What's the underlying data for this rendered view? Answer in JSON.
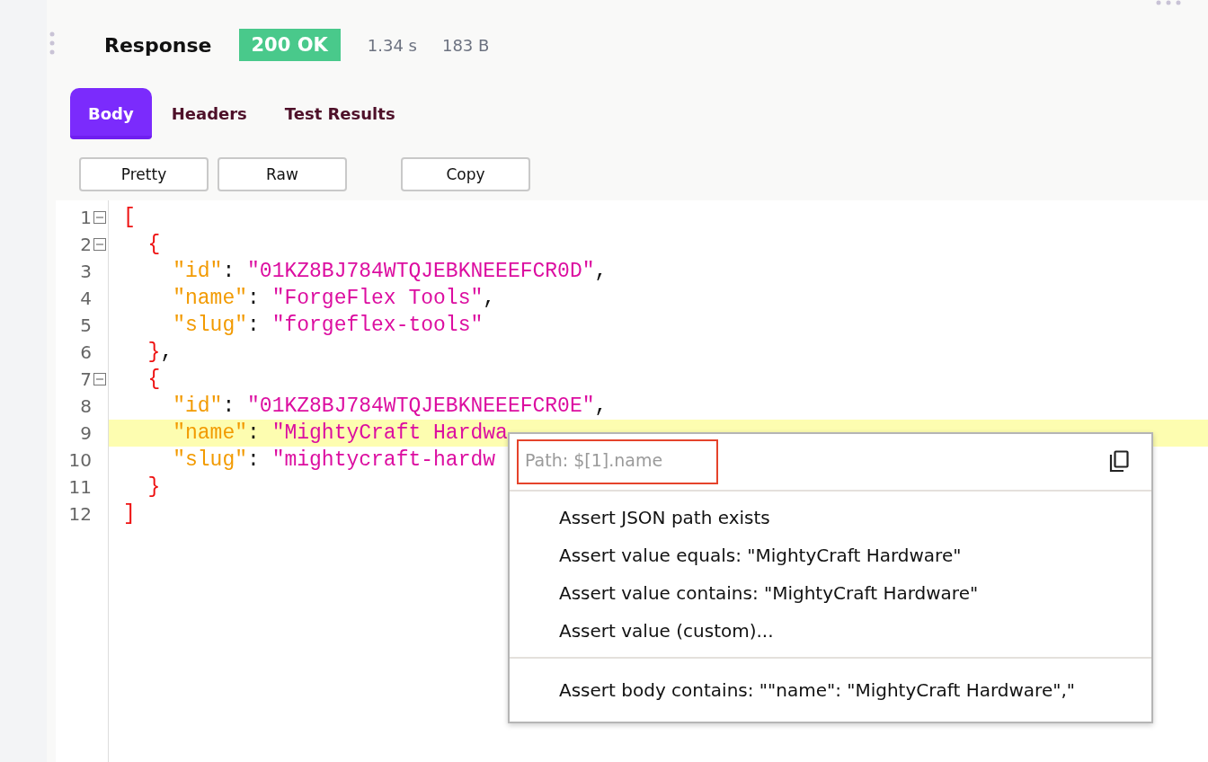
{
  "response": {
    "title": "Response",
    "status": "200 OK",
    "time": "1.34 s",
    "size": "183 B"
  },
  "tabs": [
    {
      "label": "Body",
      "selected": true
    },
    {
      "label": "Headers",
      "selected": false
    },
    {
      "label": "Test Results",
      "selected": false
    }
  ],
  "view_buttons": [
    "Pretty",
    "Raw"
  ],
  "copy_button": "Copy",
  "editor": {
    "lines": [
      {
        "number": "1",
        "fold": true,
        "selected": false,
        "tokens": [
          {
            "kind": "bracket",
            "text": "["
          }
        ]
      },
      {
        "number": "2",
        "fold": true,
        "selected": false,
        "tokens": [
          {
            "kind": "bracket",
            "text": "  {"
          }
        ]
      },
      {
        "number": "3",
        "fold": false,
        "selected": false,
        "tokens": [
          {
            "kind": "key",
            "text": "    \"id\""
          },
          {
            "kind": "punct",
            "text": ": "
          },
          {
            "kind": "string",
            "text": "\"01KZ8BJ784WTQJEBKNEEEFCR0D\""
          },
          {
            "kind": "punct",
            "text": ","
          }
        ]
      },
      {
        "number": "4",
        "fold": false,
        "selected": false,
        "tokens": [
          {
            "kind": "key",
            "text": "    \"name\""
          },
          {
            "kind": "punct",
            "text": ": "
          },
          {
            "kind": "string",
            "text": "\"ForgeFlex Tools\""
          },
          {
            "kind": "punct",
            "text": ","
          }
        ]
      },
      {
        "number": "5",
        "fold": false,
        "selected": false,
        "tokens": [
          {
            "kind": "key",
            "text": "    \"slug\""
          },
          {
            "kind": "punct",
            "text": ": "
          },
          {
            "kind": "string",
            "text": "\"forgeflex-tools\""
          }
        ]
      },
      {
        "number": "6",
        "fold": false,
        "selected": false,
        "tokens": [
          {
            "kind": "bracket",
            "text": "  }"
          },
          {
            "kind": "punct",
            "text": ","
          }
        ]
      },
      {
        "number": "7",
        "fold": true,
        "selected": false,
        "tokens": [
          {
            "kind": "bracket",
            "text": "  {"
          }
        ]
      },
      {
        "number": "8",
        "fold": false,
        "selected": false,
        "tokens": [
          {
            "kind": "key",
            "text": "    \"id\""
          },
          {
            "kind": "punct",
            "text": ": "
          },
          {
            "kind": "string",
            "text": "\"01KZ8BJ784WTQJEBKNEEEFCR0E\""
          },
          {
            "kind": "punct",
            "text": ","
          }
        ]
      },
      {
        "number": "9",
        "fold": false,
        "selected": true,
        "tokens": [
          {
            "kind": "key",
            "text": "    \"name\""
          },
          {
            "kind": "punct",
            "text": ": "
          },
          {
            "kind": "string",
            "text": "\"MightyCraft Hardwa"
          }
        ]
      },
      {
        "number": "10",
        "fold": false,
        "selected": false,
        "tokens": [
          {
            "kind": "key",
            "text": "    \"slug\""
          },
          {
            "kind": "punct",
            "text": ": "
          },
          {
            "kind": "string",
            "text": "\"mightycraft-hardw"
          }
        ]
      },
      {
        "number": "11",
        "fold": false,
        "selected": false,
        "tokens": [
          {
            "kind": "bracket",
            "text": "  }"
          }
        ]
      },
      {
        "number": "12",
        "fold": false,
        "selected": false,
        "tokens": [
          {
            "kind": "bracket",
            "text": "]"
          }
        ]
      }
    ]
  },
  "context_menu": {
    "path": "Path: $[1].name",
    "groups": [
      [
        "Assert JSON path exists",
        "Assert value equals: \"MightyCraft Hardware\"",
        "Assert value contains: \"MightyCraft Hardware\"",
        "Assert value (custom)..."
      ],
      [
        "Assert body contains: \"\"name\": \"MightyCraft Hardware\",\""
      ]
    ]
  }
}
